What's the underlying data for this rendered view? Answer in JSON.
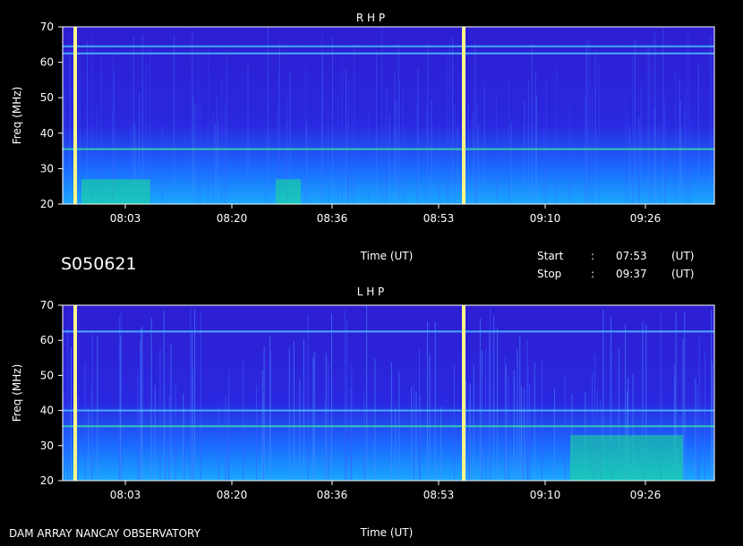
{
  "chart_data": [
    {
      "type": "heatmap",
      "title": "R H P",
      "ylabel": "Freq (MHz)",
      "xlabel": "Time (UT)",
      "xlim": [
        "07:53",
        "09:37"
      ],
      "ylim": [
        20,
        70
      ],
      "yticks": [
        "20",
        "30",
        "40",
        "50",
        "60",
        "70"
      ],
      "xticks": [
        "08:03",
        "08:20",
        "08:36",
        "08:53",
        "09:10",
        "09:26"
      ],
      "vertical_lines_ut": [
        "07:55",
        "08:57"
      ],
      "horizontal_lines_mhz": [
        35.5,
        64.5,
        62.5
      ],
      "bright_bursts": [
        {
          "from": "07:56",
          "to": "08:07",
          "fmin": 20,
          "fmax": 27
        },
        {
          "from": "08:27",
          "to": "08:31",
          "fmin": 20,
          "fmax": 27
        }
      ],
      "grid": false
    },
    {
      "type": "heatmap",
      "title": "L H P",
      "ylabel": "Freq (MHz)",
      "xlabel": "Time (UT)",
      "xlim": [
        "07:53",
        "09:37"
      ],
      "ylim": [
        20,
        70
      ],
      "yticks": [
        "20",
        "30",
        "40",
        "50",
        "60",
        "70"
      ],
      "xticks": [
        "08:03",
        "08:20",
        "08:36",
        "08:53",
        "09:10",
        "09:26"
      ],
      "vertical_lines_ut": [
        "07:55",
        "08:57"
      ],
      "horizontal_lines_mhz": [
        35.5,
        62.5,
        40
      ],
      "bright_bursts": [
        {
          "from": "09:14",
          "to": "09:32",
          "fmin": 20,
          "fmax": 33
        }
      ],
      "grid": false
    }
  ],
  "labels": {
    "session_id": "S050621",
    "time_axis_label": "Time (UT)",
    "start_label": "Start",
    "stop_label": "Stop",
    "colon": ":",
    "start_value": "07:53",
    "stop_value": "09:37",
    "ut_unit": "(UT)",
    "observatory": "DAM ARRAY  NANCAY OBSERVATORY"
  },
  "colors": {
    "background": "#000000",
    "spectrum_base": "#2d1ed2",
    "spectrum_low": "#1a6aff",
    "spectrum_burst": "#19e08a",
    "line_color": "#fff68a",
    "axis_color": "#ffffff"
  }
}
